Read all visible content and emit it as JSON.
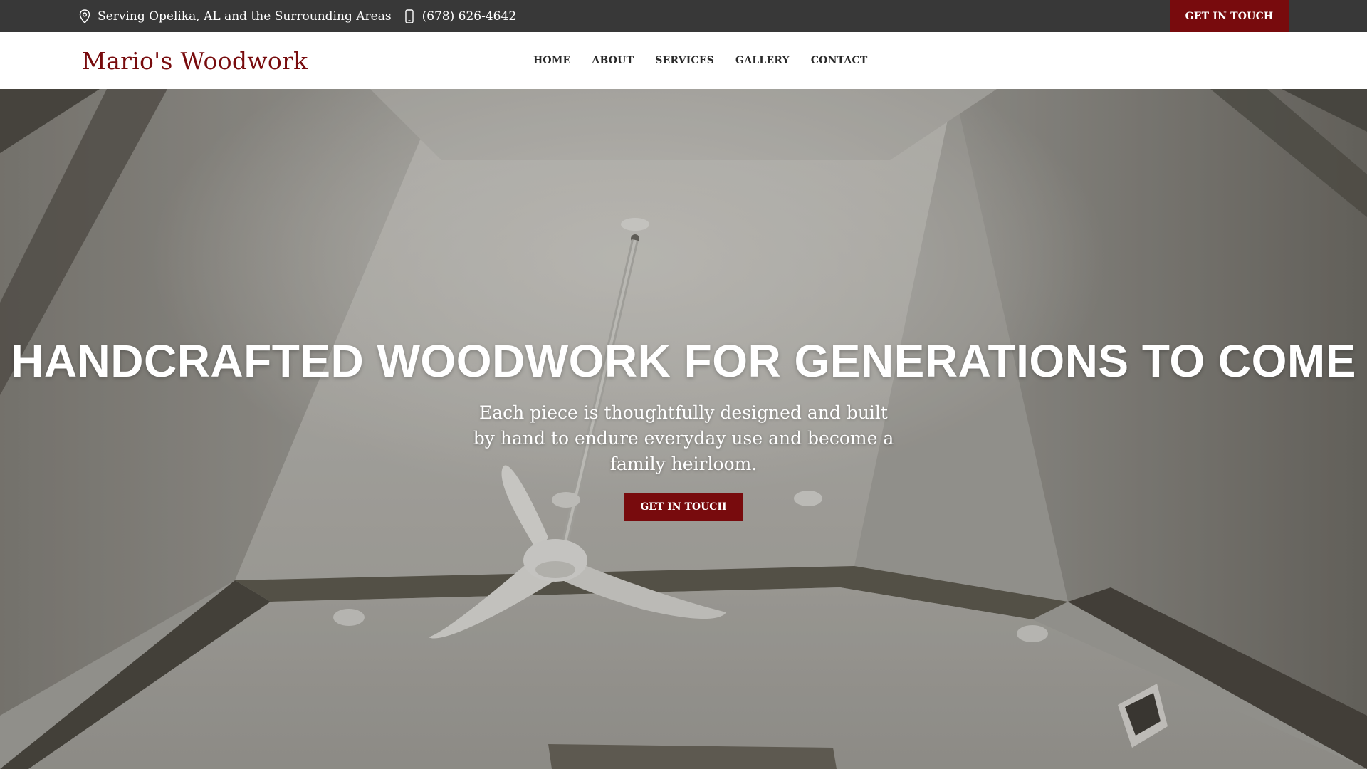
{
  "topbar": {
    "location_text": "Serving Opelika, AL and the Surrounding Areas",
    "location_icon": "map-pin-icon",
    "phone_text": "(678) 626-4642",
    "phone_icon": "mobile-phone-icon",
    "cta_label": "GET IN TOUCH"
  },
  "header": {
    "logo_text": "Mario's Woodwork",
    "nav": [
      {
        "label": "HOME"
      },
      {
        "label": "ABOUT"
      },
      {
        "label": "SERVICES"
      },
      {
        "label": "GALLERY"
      },
      {
        "label": "CONTACT"
      }
    ]
  },
  "hero": {
    "title": "HANDCRAFTED WOODWORK FOR GENERATIONS TO COME",
    "subtitle": "Each piece is thoughtfully designed and built by hand to endure everyday use and become a family heirloom.",
    "cta_label": "GET IN TOUCH",
    "background_image": "vaulted-ceiling-with-fan-photo"
  },
  "colors": {
    "brand": "#780b0d",
    "topbar_bg": "#383838",
    "header_bg": "#ffffff",
    "nav_text": "#2a2a2a"
  }
}
